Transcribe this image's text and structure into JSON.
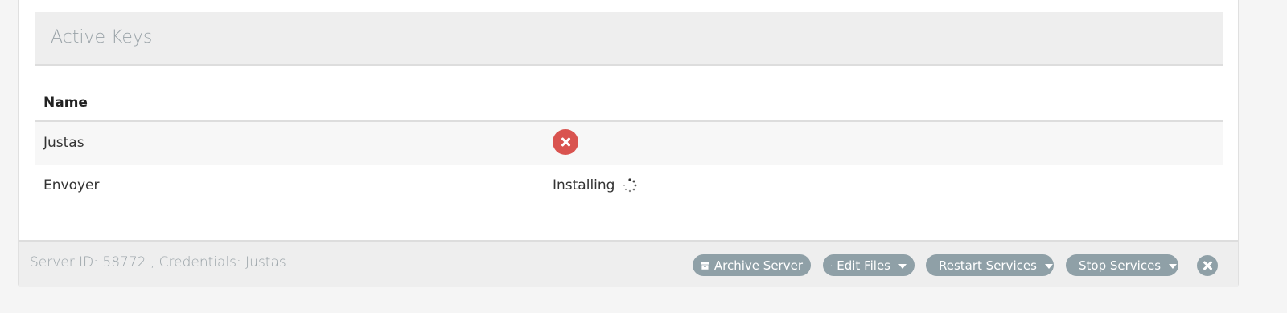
{
  "panel": {
    "title": "Active Keys"
  },
  "table": {
    "headers": [
      "Name",
      ""
    ],
    "rows": [
      {
        "name": "Justas",
        "action": "delete"
      },
      {
        "name": "Envoyer",
        "status": "Installing"
      }
    ]
  },
  "footer": {
    "info": "Server ID: 58772 , Credentials: Justas",
    "buttons": {
      "archive": "Archive Server",
      "edit": "Edit Files",
      "restart": "Restart Services",
      "stop": "Stop Services"
    }
  },
  "icons": {
    "delete": "times-circle-icon",
    "spinner": "spinner-icon",
    "archive": "archive-icon",
    "edit": "edit-icon",
    "restart": "refresh-icon",
    "stop": "warning-icon",
    "close": "close-icon"
  },
  "colors": {
    "danger": "#d9534f",
    "pill": "#8fa0a7",
    "muted_text": "#9aa3a8"
  }
}
